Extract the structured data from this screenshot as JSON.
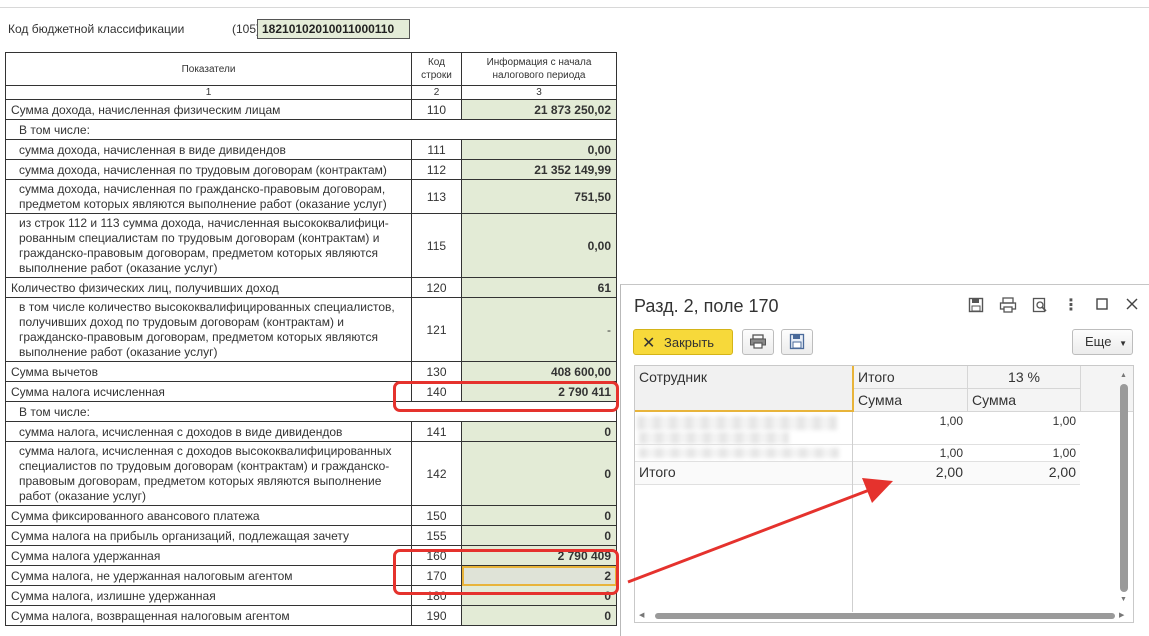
{
  "kbk": {
    "label": "Код бюджетной классификации",
    "code": "(105)",
    "value": "18210102010011000110"
  },
  "table": {
    "headers": [
      "Показатели",
      "Код строки",
      "Информация с начала налогового периода"
    ],
    "numbers": [
      "1",
      "2",
      "3"
    ],
    "rows": [
      {
        "label": "Сумма дохода, начисленная физическим лицам",
        "code": "110",
        "value": "21 873 250,02"
      },
      {
        "label": "В том числе:",
        "code": "",
        "value": ""
      },
      {
        "label": "сумма дохода, начисленная в виде дивидендов",
        "code": "111",
        "value": "0,00"
      },
      {
        "label": "сумма дохода, начисленная по трудовым договорам (контрактам)",
        "code": "112",
        "value": "21 352 149,99"
      },
      {
        "label": "сумма дохода, начисленная по гражданско-правовым договорам, предметом которых являются выполнение работ (оказание услуг)",
        "code": "113",
        "value": "751,50"
      },
      {
        "label": "из строк 112 и 113 сумма дохода, начисленная высококвалифици-рованным специалистам по трудовым договорам (контрактам) и гражданско-правовым договорам, предметом которых являются выполнение работ (оказание услуг)",
        "code": "115",
        "value": "0,00"
      },
      {
        "label": "Количество физических лиц, получивших доход",
        "code": "120",
        "value": "61"
      },
      {
        "label": "в том числе количество высококвалифицированных специалистов, получивших доход по трудовым договорам (контрактам) и гражданско-правовым договорам, предметом которых являются выполнение работ (оказание услуг)",
        "code": "121",
        "value": "-"
      },
      {
        "label": "Сумма вычетов",
        "code": "130",
        "value": "408 600,00"
      },
      {
        "label": "Сумма налога исчисленная",
        "code": "140",
        "value": "2 790 411"
      },
      {
        "label": "В том числе:",
        "code": "",
        "value": ""
      },
      {
        "label": "сумма налога, исчисленная с доходов в виде дивидендов",
        "code": "141",
        "value": "0"
      },
      {
        "label": "сумма налога, исчисленная с доходов высококвалифицированных специалистов по трудовым договорам (контрактам) и гражданско-правовым договорам, предметом которых являются выполнение работ (оказание услуг)",
        "code": "142",
        "value": "0"
      },
      {
        "label": "Сумма фиксированного авансового платежа",
        "code": "150",
        "value": "0"
      },
      {
        "label": "Сумма налога на прибыль организаций, подлежащая зачету",
        "code": "155",
        "value": "0"
      },
      {
        "label": "Сумма налога удержанная",
        "code": "160",
        "value": "2 790 409"
      },
      {
        "label": "Сумма налога, не удержанная налоговым агентом",
        "code": "170",
        "value": "2"
      },
      {
        "label": "Сумма налога, излишне удержанная",
        "code": "180",
        "value": "0"
      },
      {
        "label": "Сумма налога, возвращенная налоговым агентом",
        "code": "190",
        "value": "0"
      }
    ]
  },
  "popup": {
    "title": "Разд. 2, поле 170",
    "close_label": "Закрыть",
    "more_label": "Еще",
    "grid": {
      "col_employee": "Сотрудник",
      "col_total": "Итого",
      "col_rate": "13 %",
      "sub_sum1": "Сумма",
      "sub_sum2": "Сумма",
      "rows": [
        {
          "v1": "1,00",
          "v2": "1,00"
        },
        {
          "v1": "1,00",
          "v2": "1,00"
        }
      ],
      "total_label": "Итого",
      "total_v1": "2,00",
      "total_v2": "2,00"
    }
  }
}
